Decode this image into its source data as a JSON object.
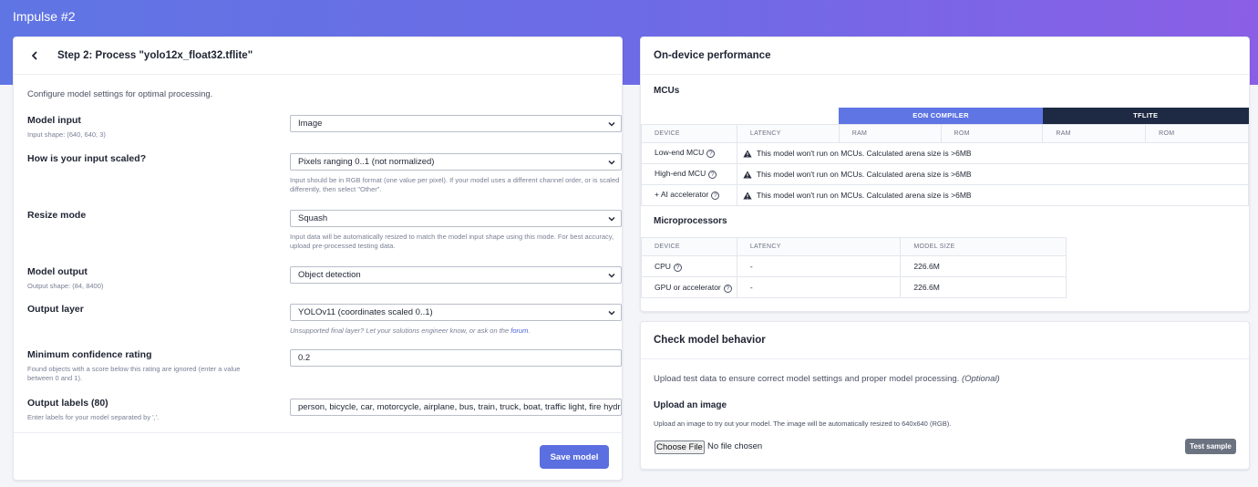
{
  "header": {
    "title": "Impulse #2"
  },
  "process_card": {
    "title": "Step 2: Process \"yolo12x_float32.tflite\"",
    "lead": "Configure model settings for optimal processing.",
    "fields": {
      "model_input": {
        "label": "Model input",
        "sub": "Input shape: (640, 640, 3)",
        "value": "Image"
      },
      "input_scaled": {
        "label": "How is your input scaled?",
        "value": "Pixels ranging 0..1 (not normalized)",
        "hint": "Input should be in RGB format (one value per pixel). If your model uses a different channel order, or is scaled differently, then select \"Other\"."
      },
      "resize_mode": {
        "label": "Resize mode",
        "value": "Squash",
        "hint": "Input data will be automatically resized to match the model input shape using this mode. For best accuracy, upload pre-processed testing data."
      },
      "model_output": {
        "label": "Model output",
        "sub": "Output shape: (84, 8400)",
        "value": "Object detection"
      },
      "output_layer": {
        "label": "Output layer",
        "value": "YOLOv11 (coordinates scaled 0..1)",
        "hint_prefix": "Unsupported final layer? Let your solutions engineer know, or ask on the ",
        "hint_link": "forum",
        "hint_suffix": "."
      },
      "min_confidence": {
        "label": "Minimum confidence rating",
        "sub": "Found objects with a score below this rating are ignored (enter a value between 0 and 1).",
        "value": "0.2"
      },
      "output_labels": {
        "label": "Output labels (80)",
        "sub": "Enter labels for your model separated by ','.",
        "value": "person, bicycle, car, motorcycle, airplane, bus, train, truck, boat, traffic light, fire hydrant"
      }
    },
    "save_label": "Save model"
  },
  "performance_card": {
    "title": "On-device performance",
    "mcus": {
      "title": "MCUs",
      "compilers": [
        "EON COMPILER",
        "TFLITE"
      ],
      "columns": [
        "DEVICE",
        "LATENCY",
        "RAM",
        "ROM",
        "RAM",
        "ROM"
      ],
      "rows": [
        {
          "device": "Low-end MCU",
          "message": "This model won't run on MCUs. Calculated arena size is >6MB"
        },
        {
          "device": "High-end MCU",
          "message": "This model won't run on MCUs. Calculated arena size is >6MB"
        },
        {
          "device": "+ AI accelerator",
          "message": "This model won't run on MCUs. Calculated arena size is >6MB"
        }
      ]
    },
    "microprocessors": {
      "title": "Microprocessors",
      "columns": [
        "DEVICE",
        "LATENCY",
        "MODEL SIZE"
      ],
      "rows": [
        {
          "device": "CPU",
          "latency": "-",
          "size": "226.6M"
        },
        {
          "device": "GPU or accelerator",
          "latency": "-",
          "size": "226.6M"
        }
      ]
    }
  },
  "check_card": {
    "title": "Check model behavior",
    "desc": "Upload test data to ensure correct model settings and proper model processing.",
    "desc_optional": "(Optional)",
    "upload_title": "Upload an image",
    "upload_desc": "Upload an image to try out your model. The image will be automatically resized to 640x640 (RGB).",
    "choose_label": "Choose File",
    "no_file": "No file chosen",
    "test_label": "Test sample"
  },
  "colors": {
    "accent": "#5b6fe0",
    "eon": "#5f75e4",
    "tflite": "#1e2a44",
    "warn": "#252a38"
  }
}
